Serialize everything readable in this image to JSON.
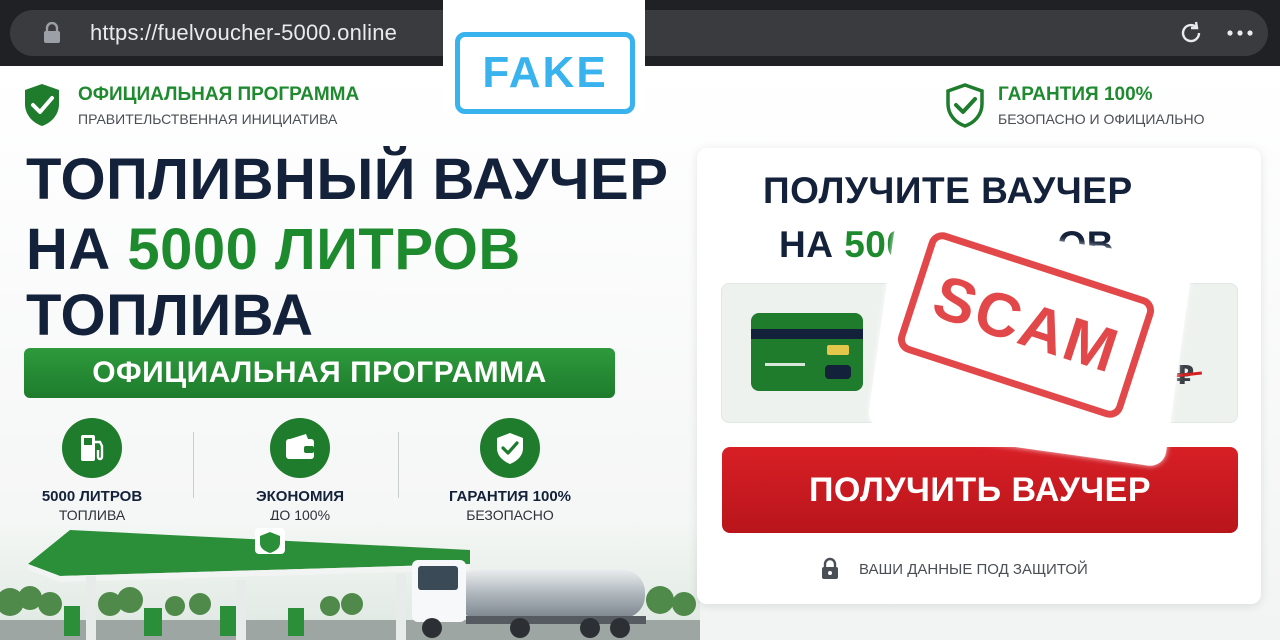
{
  "browser": {
    "url": "https://fuelvoucher-5000.online"
  },
  "overlays": {
    "fake_label": "FAKE",
    "scam_label": "SCAM"
  },
  "header": {
    "official_title": "ОФИЦИАЛЬНАЯ ПРОГРАММА",
    "official_sub": "ПРАВИТЕЛЬСТВЕННАЯ ИНИЦИАТИВА",
    "guarantee_title": "ГАРАНТИЯ 100%",
    "guarantee_sub": "БЕЗОПАСНО И ОФИЦИАЛЬНО"
  },
  "hero": {
    "line1": "ТОПЛИВНЫЙ ВАУЧЕР",
    "line2_prefix": "НА ",
    "line2_highlight": "5000 ЛИТРОВ",
    "line3": "ТОПЛИВА",
    "band": "ОФИЦИАЛЬНАЯ ПРОГРАММА"
  },
  "features": [
    {
      "title": "5000 ЛИТРОВ",
      "sub": "ТОПЛИВА",
      "icon": "fuel-pump-icon"
    },
    {
      "title": "ЭКОНОМИЯ",
      "sub": "ДО 100%",
      "icon": "wallet-icon"
    },
    {
      "title": "ГАРАНТИЯ 100%",
      "sub": "БЕЗОПАСНО",
      "icon": "shield-check-icon"
    }
  ],
  "card": {
    "heading_line1": "ПОЛУЧИТЕ ВАУЧЕР",
    "heading_line2_prefix": "НА ",
    "heading_line2_highlight": "500",
    "heading_line2_tail": "ОВ",
    "old_price": "90 ₽",
    "cta": "ПОЛУЧИТЬ ВАУЧЕР",
    "secure_note": "ВАШИ ДАННЫЕ ПОД ЗАЩИТОЙ"
  },
  "colors": {
    "brand_green": "#1e8a2e",
    "cta_red": "#d81f26",
    "fake_blue": "#38b3ee",
    "scam_red": "#e2484a",
    "navy_text": "#14213a"
  }
}
